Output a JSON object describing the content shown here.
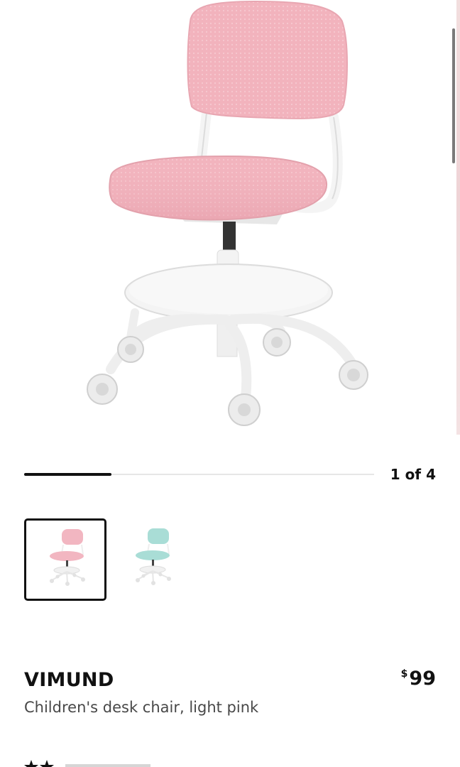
{
  "gallery": {
    "current": 1,
    "total": 4,
    "counter_text": "1 of 4",
    "progress_fraction": 0.25
  },
  "thumbnails": [
    {
      "label": "light pink",
      "color": "#f2b6c1",
      "selected": true
    },
    {
      "label": "turquoise",
      "color": "#a9ddd6",
      "selected": false
    }
  ],
  "product": {
    "name": "VIMUND",
    "description": "Children's desk chair, light pink",
    "currency": "$",
    "price": "99"
  },
  "icons": {
    "rating": "star-icon"
  }
}
